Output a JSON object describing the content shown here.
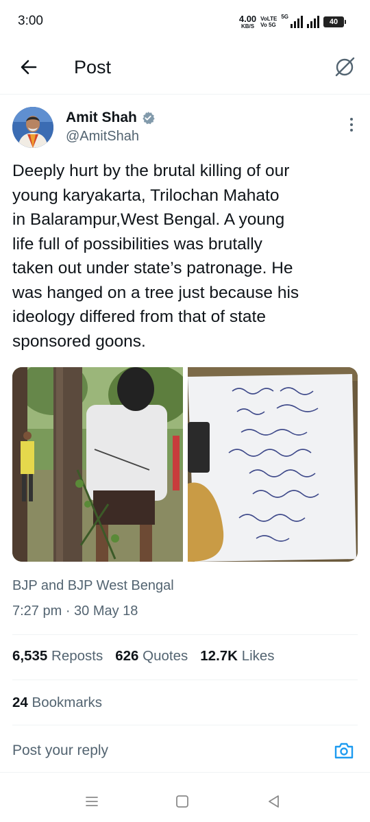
{
  "status_bar": {
    "time": "3:00",
    "net_speed_value": "4.00",
    "net_speed_unit": "KB/S",
    "volte_1": "VoLTE",
    "volte_2": "Vo 5G",
    "network_type": "5G",
    "battery": "40"
  },
  "header": {
    "title": "Post",
    "back_icon": "arrow-left-icon",
    "grok_icon": "grok-icon"
  },
  "tweet": {
    "author_name": "Amit Shah",
    "author_handle": "@AmitShah",
    "verified_color": "#829aab",
    "text": "Deeply hurt by the brutal killing of our\nyoung karyakarta, Trilochan Mahato\nin Balarampur,West Bengal. A young\nlife full of possibilities was brutally\ntaken out under state’s patronage. He\nwas hanged on a tree just because his\nideology differed from that of state\nsponsored goons.",
    "caption": "BJP and BJP West Bengal",
    "timestamp": "7:27 pm · 30 May 18",
    "media_count": 2
  },
  "stats": {
    "reposts_count": "6,535",
    "reposts_label": "Reposts",
    "quotes_count": "626",
    "quotes_label": "Quotes",
    "likes_count": "12.7K",
    "likes_label": "Likes",
    "bookmarks_count": "24",
    "bookmarks_label": "Bookmarks"
  },
  "reply": {
    "placeholder": "Post your reply",
    "camera_icon": "camera-icon",
    "accent_color": "#1d9bf0"
  },
  "nav_bar": {
    "icons": [
      "menu-icon",
      "home-square-icon",
      "back-triangle-icon"
    ]
  }
}
